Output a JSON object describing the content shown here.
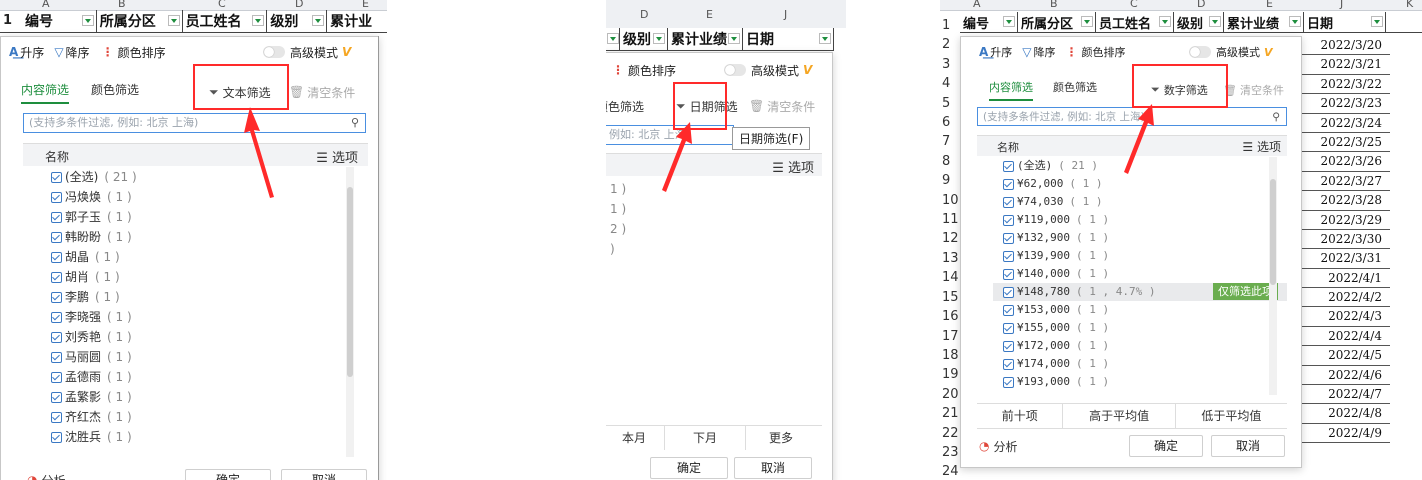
{
  "toolbar": {
    "asc": "升序",
    "desc": "降序",
    "color_sort": "颜色排序",
    "advanced": "高级模式",
    "vip": "V"
  },
  "tabs": {
    "content": "内容筛选",
    "color": "颜色筛选",
    "clear": "清空条件"
  },
  "search_placeholder": "(支持多条件过滤, 例如: 北京 上海)",
  "list_header": {
    "name": "名称",
    "options": "选项"
  },
  "footer": {
    "analysis": "分析",
    "ok": "确定",
    "cancel": "取消"
  },
  "panel1": {
    "col_letters": [
      "A",
      "B",
      "C",
      "D",
      "E"
    ],
    "row_number": "1",
    "headers": [
      "编号",
      "所属分区",
      "员工姓名",
      "级别",
      "累计业"
    ],
    "filter_type": "文本筛选",
    "items": [
      {
        "label": "(全选)",
        "count": "( 21 )"
      },
      {
        "label": "冯焕焕",
        "count": "( 1 )"
      },
      {
        "label": "郭子玉",
        "count": "( 1 )"
      },
      {
        "label": "韩盼盼",
        "count": "( 1 )"
      },
      {
        "label": "胡晶",
        "count": "( 1 )"
      },
      {
        "label": "胡肖",
        "count": "( 1 )"
      },
      {
        "label": "李鹏",
        "count": "( 1 )"
      },
      {
        "label": "李晓强",
        "count": "( 1 )"
      },
      {
        "label": "刘秀艳",
        "count": "( 1 )"
      },
      {
        "label": "马丽圆",
        "count": "( 1 )"
      },
      {
        "label": "孟德雨",
        "count": "( 1 )"
      },
      {
        "label": "孟繁影",
        "count": "( 1 )"
      },
      {
        "label": "齐红杰",
        "count": "( 1 )"
      },
      {
        "label": "沈胜兵",
        "count": "( 1 )"
      }
    ]
  },
  "panel2": {
    "col_letters": [
      "D",
      "E",
      "J"
    ],
    "headers": [
      "级别",
      "累计业绩",
      "日期"
    ],
    "filter_type": "日期筛选",
    "tooltip": "日期筛选(F)",
    "search_partial": "例如: 北京 上海",
    "partial_counts": [
      "1 )",
      "1 )",
      "2 )",
      ")"
    ],
    "bottom_buttons": [
      "本月",
      "下月",
      "更多"
    ]
  },
  "panel3": {
    "col_letters": [
      "A",
      "B",
      "C",
      "D",
      "E",
      "J",
      "K"
    ],
    "headers": [
      "编号",
      "所属分区",
      "员工姓名",
      "级别",
      "累计业绩",
      "日期"
    ],
    "row_numbers": [
      "1",
      "2",
      "3",
      "4",
      "5",
      "6",
      "7",
      "8",
      "9",
      "10",
      "11",
      "12",
      "13",
      "14",
      "15",
      "16",
      "17",
      "18",
      "19",
      "20",
      "21",
      "22",
      "23",
      "24"
    ],
    "filter_type": "数字筛选",
    "items": [
      {
        "label": "(全选)",
        "count": "( 21 )"
      },
      {
        "label": "¥62,000",
        "count": "( 1 )"
      },
      {
        "label": "¥74,030",
        "count": "( 1 )"
      },
      {
        "label": "¥119,000",
        "count": "( 1 )"
      },
      {
        "label": "¥132,900",
        "count": "( 1 )"
      },
      {
        "label": "¥139,900",
        "count": "( 1 )"
      },
      {
        "label": "¥140,000",
        "count": "( 1 )"
      },
      {
        "label": "¥148,780",
        "count": "( 1 , 4.7% )"
      },
      {
        "label": "¥153,000",
        "count": "( 1 )"
      },
      {
        "label": "¥155,000",
        "count": "( 1 )"
      },
      {
        "label": "¥172,000",
        "count": "( 1 )"
      },
      {
        "label": "¥174,000",
        "count": "( 1 )"
      },
      {
        "label": "¥193,000",
        "count": "( 1 )"
      }
    ],
    "only_this": "仅筛选此项",
    "quick_buttons": [
      "前十项",
      "高于平均值",
      "低于平均值"
    ],
    "dates": [
      "2022/3/20",
      "2022/3/21",
      "2022/3/22",
      "2022/3/23",
      "2022/3/24",
      "2022/3/25",
      "2022/3/26",
      "2022/3/27",
      "2022/3/28",
      "2022/3/29",
      "2022/3/30",
      "2022/3/31",
      "2022/4/1",
      "2022/4/2",
      "2022/4/3",
      "2022/4/4",
      "2022/4/5",
      "2022/4/6",
      "2022/4/7",
      "2022/4/8",
      "2022/4/9"
    ]
  },
  "colors": {
    "accent_green": "#1e8e3e",
    "highlight_red": "#ff2a2a",
    "search_border": "#4a8fe0",
    "tag_green": "#6aad4f"
  }
}
